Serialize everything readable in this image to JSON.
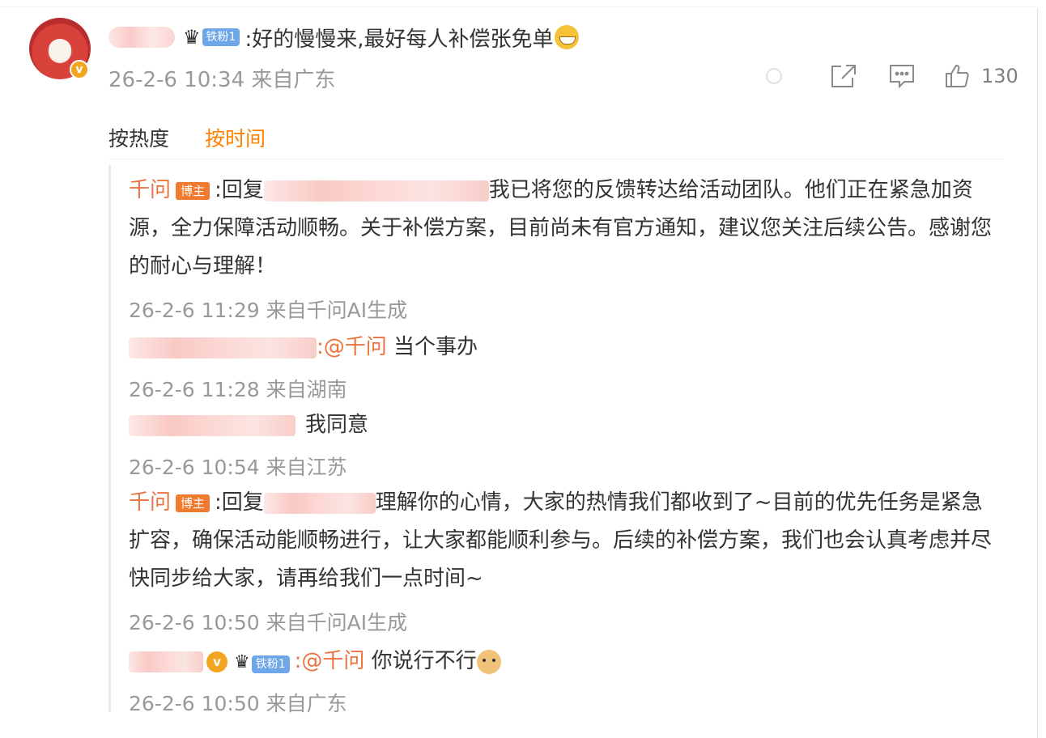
{
  "main_comment": {
    "badge": "铁粉1",
    "text": ":好的慢慢来,最好每人补偿张免单",
    "emoji": "grin-emoji",
    "timestamp": "26-2-6 10:34 来自广东",
    "like_count": "130"
  },
  "sort": {
    "hot": "按热度",
    "time": "按时间"
  },
  "replies": [
    {
      "name": "千问",
      "badge": "博主",
      "reply_prefix": ":回复",
      "text": "我已将您的反馈转达给活动团队。他们正在紧急加资源，全力保障活动顺畅。关于补偿方案，目前尚未有官方通知，建议您关注后续公告。感谢您的耐心与理解！",
      "timestamp": "26-2-6 11:29 来自千问AI生成"
    },
    {
      "mention": ":@千问",
      "text": " 当个事办",
      "timestamp": "26-2-6 11:28 来自湖南"
    },
    {
      "text": "我同意",
      "timestamp": "26-2-6 10:54 来自江苏"
    },
    {
      "name": "千问",
      "badge": "博主",
      "reply_prefix": ":回复",
      "text": "理解你的心情，大家的热情我们都收到了~目前的优先任务是紧急扩容，确保活动能顺畅进行，让大家都能顺利参与。后续的补偿方案，我们也会认真考虑并尽快同步给大家，请再给我们一点时间~",
      "timestamp": "26-2-6 10:50 来自千问AI生成"
    },
    {
      "fan_badge": "铁粉1",
      "mention": ":@千问",
      "text": " 你说行不行",
      "emoji": "doge-emoji",
      "timestamp": "26-2-6 10:50 来自广东"
    }
  ],
  "colors": {
    "accent": "#ff8200",
    "name_link": "#eb7340",
    "host_badge": "#f27a2f",
    "fan_badge": "#6ea7e8",
    "meta_gray": "#999999"
  }
}
